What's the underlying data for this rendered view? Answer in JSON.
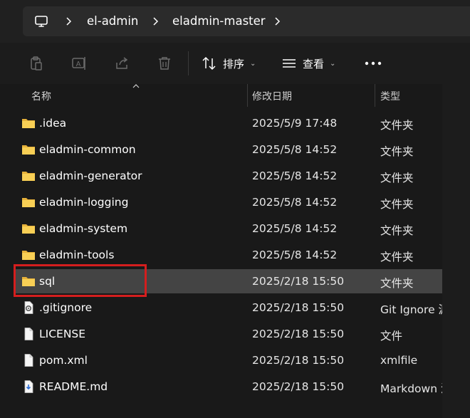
{
  "breadcrumb": {
    "items": [
      {
        "label": "el-admin"
      },
      {
        "label": "eladmin-master"
      }
    ]
  },
  "toolbar": {
    "sort_label": "排序",
    "view_label": "查看",
    "more_label": "…"
  },
  "columns": {
    "name": "名称",
    "date": "修改日期",
    "type": "类型"
  },
  "files": [
    {
      "name": ".idea",
      "date": "2025/5/9 17:48",
      "type": "文件夹",
      "icon": "folder-icon"
    },
    {
      "name": "eladmin-common",
      "date": "2025/5/8 14:52",
      "type": "文件夹",
      "icon": "folder-icon"
    },
    {
      "name": "eladmin-generator",
      "date": "2025/5/8 14:52",
      "type": "文件夹",
      "icon": "folder-icon"
    },
    {
      "name": "eladmin-logging",
      "date": "2025/5/8 14:52",
      "type": "文件夹",
      "icon": "folder-icon"
    },
    {
      "name": "eladmin-system",
      "date": "2025/5/8 14:52",
      "type": "文件夹",
      "icon": "folder-icon"
    },
    {
      "name": "eladmin-tools",
      "date": "2025/5/8 14:52",
      "type": "文件夹",
      "icon": "folder-icon"
    },
    {
      "name": "sql",
      "date": "2025/2/18 15:50",
      "type": "文件夹",
      "icon": "folder-icon",
      "selected": true
    },
    {
      "name": ".gitignore",
      "date": "2025/2/18 15:50",
      "type": "Git Ignore 源",
      "icon": "settings-file-icon"
    },
    {
      "name": "LICENSE",
      "date": "2025/2/18 15:50",
      "type": "文件",
      "icon": "file-icon"
    },
    {
      "name": "pom.xml",
      "date": "2025/2/18 15:50",
      "type": "xmlfile",
      "icon": "file-icon"
    },
    {
      "name": "README.md",
      "date": "2025/2/18 15:50",
      "type": "Markdown 源",
      "icon": "markdown-file-icon"
    }
  ],
  "colors": {
    "highlight": "#d41e1e",
    "folder": "#f2c94c",
    "selected_row": "#444444"
  }
}
